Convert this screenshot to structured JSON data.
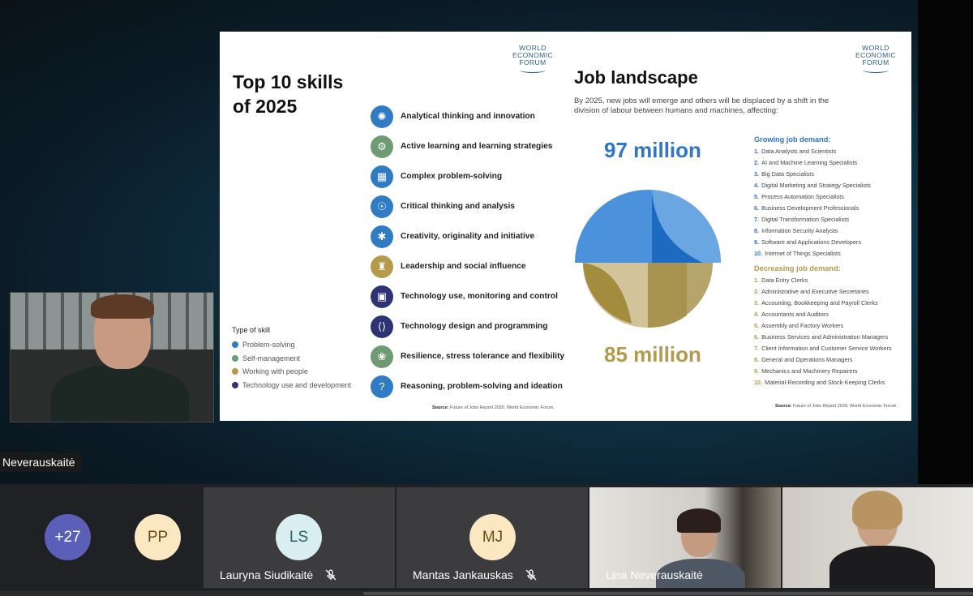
{
  "slide": {
    "left": {
      "logo": "WORLD\nECONOMIC\nFORUM",
      "title": "Top 10 skills\nof 2025",
      "skills": [
        {
          "label": "Analytical thinking and innovation",
          "type": "Problem-solving",
          "icon": "brain-icon"
        },
        {
          "label": "Active learning and learning strategies",
          "type": "Self-management",
          "icon": "cogs-icon"
        },
        {
          "label": "Complex problem-solving",
          "type": "Problem-solving",
          "icon": "puzzle-icon"
        },
        {
          "label": "Critical thinking and analysis",
          "type": "Problem-solving",
          "icon": "head-icon"
        },
        {
          "label": "Creativity, originality and initiative",
          "type": "Problem-solving",
          "icon": "idea-icon"
        },
        {
          "label": "Leadership and social influence",
          "type": "Working with people",
          "icon": "leader-icon"
        },
        {
          "label": "Technology use, monitoring and control",
          "type": "Technology use and development",
          "icon": "chip-icon"
        },
        {
          "label": "Technology design and programming",
          "type": "Technology use and development",
          "icon": "code-icon"
        },
        {
          "label": "Resilience, stress tolerance and flexibility",
          "type": "Self-management",
          "icon": "plant-icon"
        },
        {
          "label": "Reasoning, problem-solving and ideation",
          "type": "Problem-solving",
          "icon": "question-icon"
        }
      ],
      "legend_title": "Type of skill",
      "legend": [
        {
          "label": "Problem-solving",
          "color": "#2f7bc4"
        },
        {
          "label": "Self-management",
          "color": "#6e9a74"
        },
        {
          "label": "Working with people",
          "color": "#b59a4e"
        },
        {
          "label": "Technology use and development",
          "color": "#2e3473"
        }
      ],
      "source_label": "Source:",
      "source_text": "Future of Jobs Report 2020, World Economic Forum."
    },
    "right": {
      "logo": "WORLD\nECONOMIC\nFORUM",
      "title": "Job landscape",
      "intro": "By 2025, new jobs will emerge and others will be displaced by a shift in the division of labour between humans and machines, affecting:",
      "growing_number": "97 million",
      "decreasing_number": "85 million",
      "growing_color": "#2f76c8",
      "decreasing_color": "#b59a4e",
      "growing_title": "Growing job demand:",
      "growing": [
        "Data Analysts and Scientists",
        "AI and Machine Learning Specialists",
        "Big Data Specialists",
        "Digital Marketing and Strategy Specialists",
        "Process Automation Specialists",
        "Business Development Professionals",
        "Digital Transformation Specialists",
        "Information Security Analysts",
        "Software and Applications Developers",
        "Internet of Things Specialists"
      ],
      "decreasing_title": "Decreasing job demand:",
      "decreasing": [
        "Data Entry Clerks",
        "Administrative and Executive Secretaries",
        "Accounting, Bookkeeping and Payroll Clerks",
        "Accountants and Auditors",
        "Assembly and Factory Workers",
        "Business Services and Administration Managers",
        "Client Information and Customer Service Workers",
        "General and Operations Managers",
        "Mechanics and Machinery Repairers",
        "Material-Recording and Stock-Keeping Clerks"
      ],
      "source_label": "Source:",
      "source_text": "Future of Jobs Report 2020, World Economic Forum."
    }
  },
  "presenter": {
    "name": "Neverauskaitė"
  },
  "participants": {
    "overflow": {
      "label": "+27",
      "color": "#5b5fb7"
    },
    "tiles": [
      {
        "initials": "PP",
        "name": "",
        "avatar_bg": "#fbe8c2",
        "avatar_fg": "#6a4c16",
        "muted": false
      },
      {
        "initials": "LS",
        "name": "Lauryna Siudikaitė",
        "avatar_bg": "#d8eef0",
        "avatar_fg": "#2e6068",
        "muted": true
      },
      {
        "initials": "MJ",
        "name": "Mantas Jankauskas",
        "avatar_bg": "#fbe8c2",
        "avatar_fg": "#6a4c16",
        "muted": true
      },
      {
        "initials": "",
        "name": "Lina Neverauskaitė",
        "muted": false
      },
      {
        "initials": "",
        "name": "",
        "muted": false
      }
    ]
  }
}
